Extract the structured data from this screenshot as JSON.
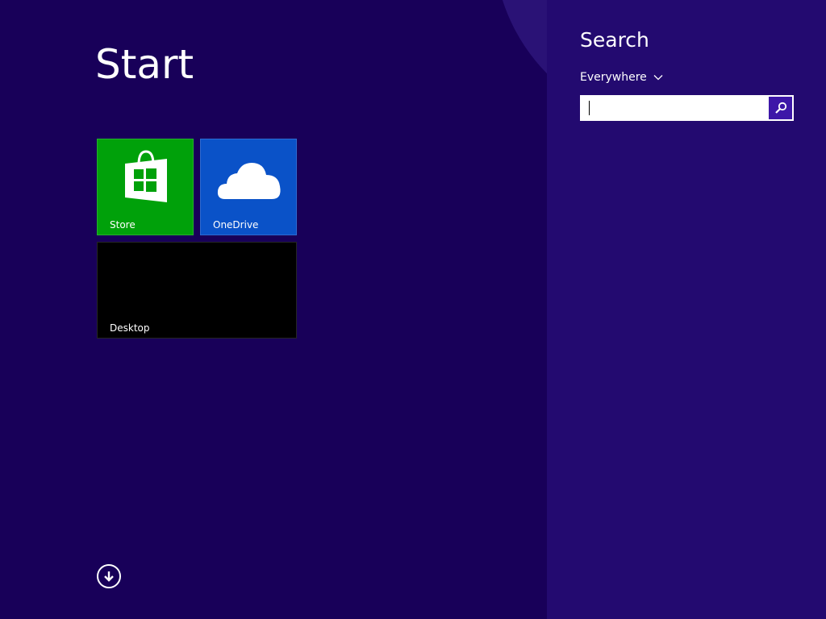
{
  "start": {
    "title": "Start",
    "tiles": [
      {
        "label": "Store",
        "icon": "store-icon",
        "color": "#00a10a"
      },
      {
        "label": "OneDrive",
        "icon": "cloud-icon",
        "color": "#0a52c8"
      },
      {
        "label": "Desktop",
        "icon": "",
        "color": "#000000"
      }
    ],
    "all_apps_icon": "down-arrow-circle-icon"
  },
  "search": {
    "title": "Search",
    "scope": "Everywhere",
    "input_value": "",
    "button_icon": "search-icon"
  },
  "colors": {
    "background": "#180059",
    "search_pane": "#230a70",
    "accent": "#3d17a8"
  }
}
